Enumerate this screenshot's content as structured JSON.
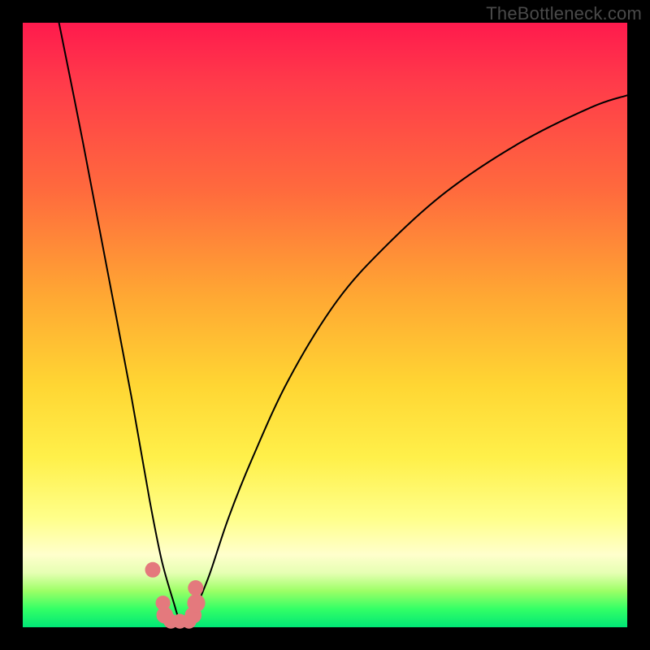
{
  "watermark": "TheBottleneck.com",
  "colors": {
    "frame": "#000000",
    "curve": "#000000",
    "markers": "#e4797d"
  },
  "chart_data": {
    "type": "line",
    "title": "",
    "xlabel": "",
    "ylabel": "",
    "xlim": [
      0,
      100
    ],
    "ylim": [
      0,
      100
    ],
    "note": "V-shaped bottleneck curve; minimum near x≈26; values read as percent of plot height from bottom (green=0, red=100). Estimated from pixel positions — no axes drawn.",
    "series": [
      {
        "name": "bottleneck-curve",
        "x": [
          6,
          10,
          14,
          18,
          21,
          23,
          25,
          26,
          27,
          28,
          29,
          31,
          34,
          38,
          44,
          52,
          60,
          70,
          82,
          94,
          100
        ],
        "y": [
          100,
          80,
          59,
          38,
          21,
          11,
          4,
          1,
          1,
          2,
          4,
          9,
          18,
          28,
          41,
          54,
          63,
          72,
          80,
          86,
          88
        ]
      }
    ],
    "markers": {
      "name": "highlighted-points",
      "shape": "circle",
      "x": [
        21.5,
        23.2,
        23.5,
        24.5,
        26.0,
        27.5,
        28.2,
        28.7,
        28.6
      ],
      "y": [
        9.5,
        4.0,
        2.0,
        1.0,
        1.0,
        1.0,
        2.0,
        4.0,
        6.5
      ],
      "r": [
        1.1,
        1.0,
        1.3,
        1.0,
        1.0,
        1.0,
        1.3,
        1.5,
        1.1
      ]
    }
  }
}
